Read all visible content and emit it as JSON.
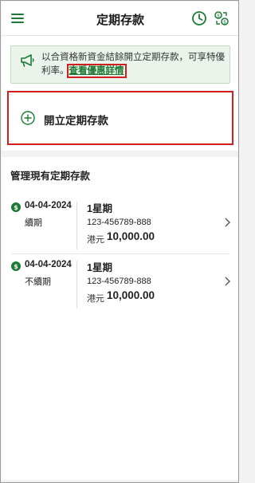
{
  "header": {
    "title": "定期存款",
    "icons": {
      "menu": "menu-icon",
      "history": "clock-icon",
      "exchange": "currency-exchange-icon"
    }
  },
  "promo": {
    "icon": "megaphone-icon",
    "text": "以合資格新資金結餘開立定期存款，可享特優利率。",
    "link_label": "查看優惠詳情"
  },
  "open_deposit": {
    "icon": "plus-circle-icon",
    "label": "開立定期存款"
  },
  "manage": {
    "title": "管理現有定期存款",
    "deposits": [
      {
        "date": "04-04-2024",
        "status": "續期",
        "term": "1星期",
        "account": "123-456789-888",
        "currency": "港元",
        "amount": "10,000.00"
      },
      {
        "date": "04-04-2024",
        "status": "不續期",
        "term": "1星期",
        "account": "123-456789-888",
        "currency": "港元",
        "amount": "10,000.00"
      }
    ]
  },
  "colors": {
    "brand_green": "#1c7a34",
    "promo_bg": "#eaf4ea",
    "highlight_red": "#d21f1f"
  }
}
